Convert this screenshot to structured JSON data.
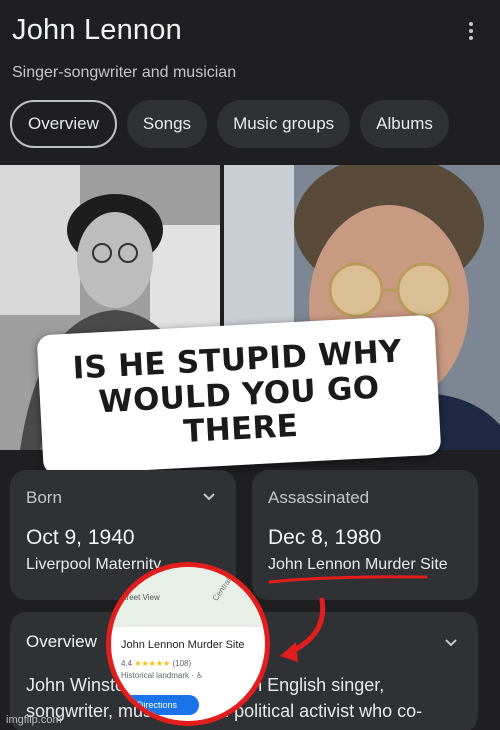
{
  "header": {
    "title": "John Lennon",
    "subtitle": "Singer-songwriter and musician"
  },
  "tabs": [
    {
      "label": "Overview",
      "active": true
    },
    {
      "label": "Songs",
      "active": false
    },
    {
      "label": "Music groups",
      "active": false
    },
    {
      "label": "Albums",
      "active": false
    }
  ],
  "meme_caption": "IS HE STUPID WHY WOULD YOU GO THERE",
  "cards": {
    "born": {
      "label": "Born",
      "date": "Oct 9, 1940",
      "place": "Liverpool Maternity"
    },
    "assassinated": {
      "label": "Assassinated",
      "date": "Dec 8, 1980",
      "place": "John Lennon Murder Site"
    }
  },
  "overview": {
    "title": "Overview",
    "text": "John Winston Lennon was an English singer, songwriter, musician, and political activist who co-"
  },
  "zoom_card": {
    "street_view": "Street View",
    "central": "Central",
    "place_name": "John Lennon Murder Site",
    "rating": "4.4",
    "stars": "★★★★★",
    "reviews": "(108)",
    "kind": "Historical landmark · ♿",
    "directions": "Directions"
  },
  "watermark": "imgflip.com",
  "colors": {
    "accent_red": "#e21d1d",
    "card_bg": "#303134",
    "page_bg": "#1f1f21"
  }
}
